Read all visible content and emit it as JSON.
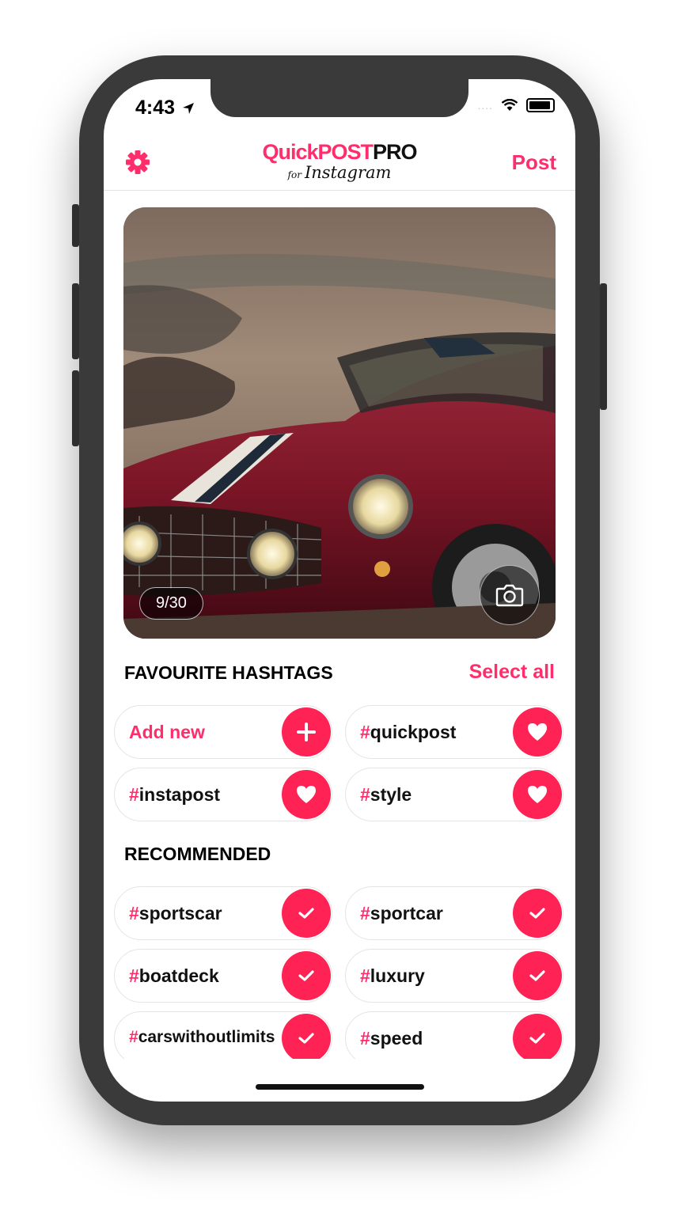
{
  "status_bar": {
    "time": "4:43",
    "dots": "....",
    "location_icon": "location-arrow-icon",
    "wifi_icon": "wifi-icon",
    "battery_icon": "battery-icon"
  },
  "nav": {
    "logo_quick": "Quick",
    "logo_post": "POST",
    "logo_pro": "PRO",
    "logo_for": "for",
    "logo_sub": "Instagram",
    "post_label": "Post",
    "settings_icon": "gear-icon"
  },
  "photo": {
    "counter": "9/30",
    "camera_icon": "camera-icon"
  },
  "favourites": {
    "title": "FAVOURITE HASHTAGS",
    "select_all": "Select all",
    "add_new": "Add new",
    "items": [
      "quickpost",
      "instapost",
      "style"
    ]
  },
  "recommended": {
    "title": "RECOMMENDED",
    "items": [
      "sportscar",
      "sportcar",
      "boatdeck",
      "luxury",
      "carswithoutlimits",
      "speed"
    ]
  },
  "hash_symbol": "#",
  "colors": {
    "accent": "#ff2d6b",
    "chip_icon": "#ff2255",
    "frame": "#3a3a3a"
  }
}
